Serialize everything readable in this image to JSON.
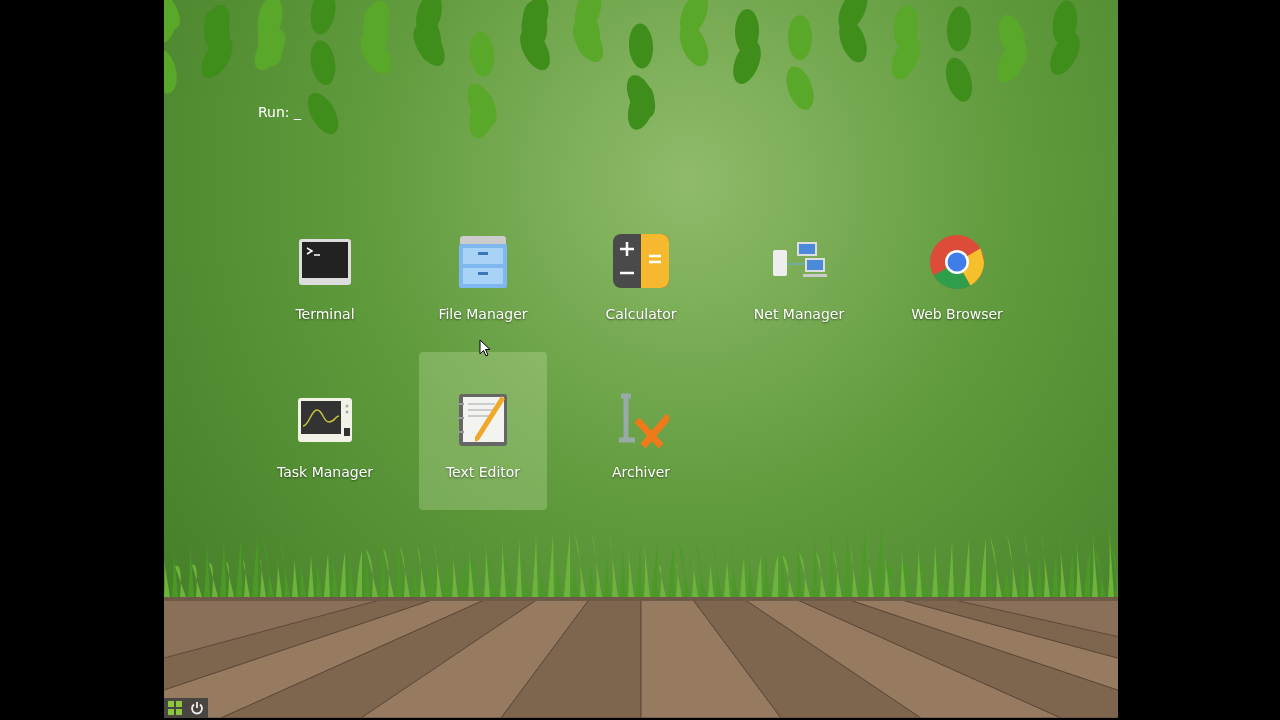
{
  "run_prompt": "Run: _",
  "apps": [
    {
      "label": "Terminal",
      "kind": "terminal",
      "selected": false
    },
    {
      "label": "File Manager",
      "kind": "files",
      "selected": false
    },
    {
      "label": "Calculator",
      "kind": "calculator",
      "selected": false
    },
    {
      "label": "Net Manager",
      "kind": "network",
      "selected": false
    },
    {
      "label": "Web Browser",
      "kind": "browser",
      "selected": false
    },
    {
      "label": "Task Manager",
      "kind": "monitor",
      "selected": false
    },
    {
      "label": "Text Editor",
      "kind": "editor",
      "selected": true
    },
    {
      "label": "Archiver",
      "kind": "archive",
      "selected": false
    }
  ]
}
